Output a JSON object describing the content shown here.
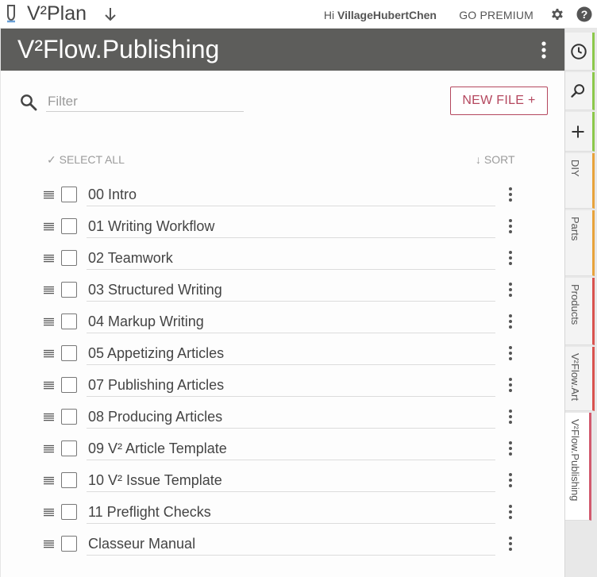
{
  "topbar": {
    "app_title": "V²Plan",
    "greeting_prefix": "Hi ",
    "username": "VillageHubertChen",
    "premium_label": "GO PREMIUM",
    "icons": [
      "logo-icon",
      "down-arrow-icon",
      "gear-icon",
      "help-icon"
    ]
  },
  "panel": {
    "title": "V²Flow.Publishing",
    "filter_placeholder": "Filter",
    "filter_value": "",
    "new_file_label": "NEW FILE +",
    "select_all_label": "✓ SELECT ALL",
    "sort_label": "↓ SORT",
    "files": [
      {
        "label": "00 Intro",
        "checked": false
      },
      {
        "label": "01 Writing Workflow",
        "checked": false
      },
      {
        "label": "02 Teamwork",
        "checked": false
      },
      {
        "label": "03 Structured Writing",
        "checked": false
      },
      {
        "label": "04 Markup Writing",
        "checked": false
      },
      {
        "label": "05 Appetizing Articles",
        "checked": false
      },
      {
        "label": "07 Publishing Articles",
        "checked": false
      },
      {
        "label": "08 Producing Articles",
        "checked": false
      },
      {
        "label": "09 V² Article Template",
        "checked": false
      },
      {
        "label": "10 V² Issue Template",
        "checked": false
      },
      {
        "label": "11 Preflight Checks",
        "checked": false
      },
      {
        "label": "Classeur Manual",
        "checked": false
      }
    ]
  },
  "right_tabs": {
    "icon_tabs": [
      "clock-icon",
      "search-icon",
      "plus-icon"
    ],
    "folder_tabs": [
      {
        "label": "DIY",
        "color": "#e8a33c"
      },
      {
        "label": "Parts",
        "color": "#e8a33c"
      },
      {
        "label": "Products",
        "color": "#d9534f"
      },
      {
        "label": "V²Flow.Art",
        "color": "#d9534f"
      },
      {
        "label": "V²Flow.Publishing",
        "color": "#d25a6e",
        "active": true
      }
    ]
  },
  "colors": {
    "header_bg": "#5d5d5b",
    "accent": "#b4475e",
    "icon_tab_accent": "#8cc84b"
  }
}
